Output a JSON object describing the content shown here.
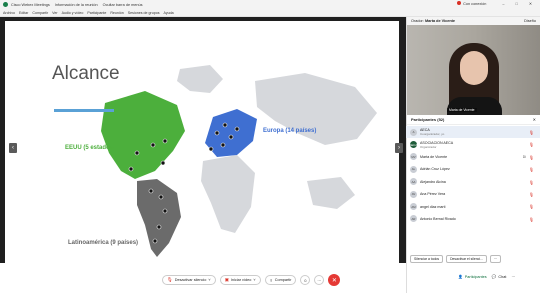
{
  "titlebar": {
    "app": "Cisco Webex Meetings",
    "info": "Información de la reunión",
    "hide_menu": "Ocultar barra de menús",
    "connection": "Con conexión",
    "minimize": "–",
    "restore": "□",
    "close": "✕"
  },
  "menubar": [
    "Archivo",
    "Editar",
    "Compartir",
    "Ver",
    "Audio y vídeo",
    "Participante",
    "Reunión",
    "Sesiones de grupos",
    "Ayuda"
  ],
  "slide": {
    "title": "Alcance",
    "label_usa": "EEUU (5 estados)",
    "label_europe": "Europa (14 países)",
    "label_latam": "Latinoamérica (9 países)",
    "watermark": "genially",
    "colors": {
      "usa": "#4caf3c",
      "europe": "#3f6fd1",
      "latam": "#6b6b6b",
      "rest": "#d6d8dc"
    }
  },
  "nav": {
    "prev": "‹",
    "next": "›"
  },
  "speaker": {
    "prefix": "Orador:",
    "name": "Marta de Vicente",
    "view_button": "Diseño"
  },
  "video": {
    "name_tag": "Marta de Vicente"
  },
  "participants": {
    "header": "Participantes (52)",
    "search_placeholder": "Buscar",
    "list": [
      {
        "initials": "A",
        "name": "AECA",
        "role": "Coorganizador, yo",
        "extra": ""
      },
      {
        "initials": "AECA",
        "name": "ASOCIACION AECA",
        "role": "Organizador",
        "extra": ""
      },
      {
        "initials": "MV",
        "name": "Marta de Vicente",
        "role": "",
        "extra": "Di"
      },
      {
        "initials": "AL",
        "name": "Adrián Cruz López",
        "role": "",
        "extra": ""
      },
      {
        "initials": "AA",
        "name": "Alejandro Alcina",
        "role": "",
        "extra": ""
      },
      {
        "initials": "AV",
        "name": "Ana Pérez Vera",
        "role": "",
        "extra": ""
      },
      {
        "initials": "AM",
        "name": "angel diaz marti",
        "role": "",
        "extra": ""
      },
      {
        "initials": "AR",
        "name": "Antonio Bernal Rivado",
        "role": "",
        "extra": ""
      }
    ]
  },
  "panel_footer": {
    "mute_all": "Silenciar a todos",
    "unmute_all": "Desactivar el silenci..."
  },
  "controls": {
    "mute": "Desactivar silencio",
    "video": "Iniciar vídeo",
    "share": "Compartir",
    "more": "···",
    "end": "✕"
  },
  "side_tabs": {
    "participants": "Participantes",
    "chat": "Chat",
    "more": "···"
  }
}
